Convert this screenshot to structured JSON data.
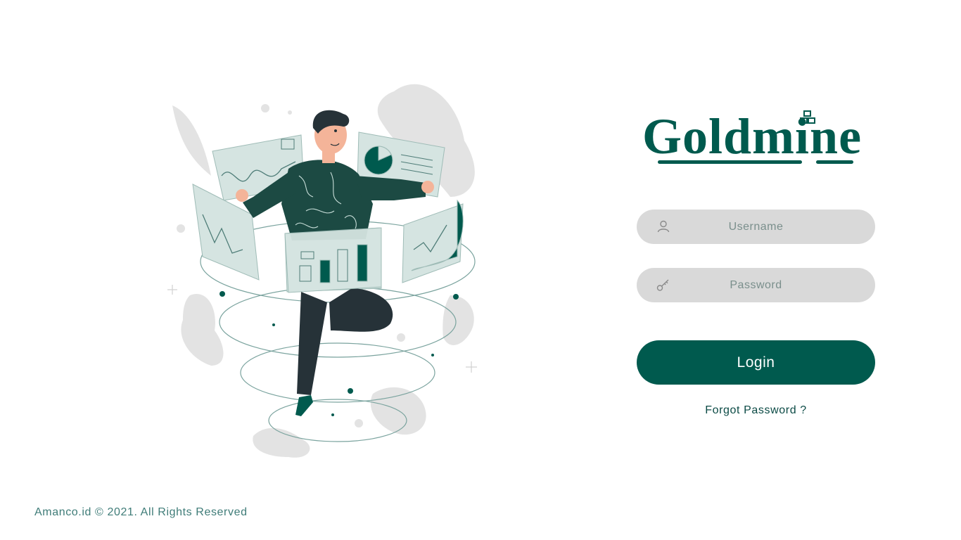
{
  "brand": {
    "name": "Goldmine",
    "color": "#005a4e"
  },
  "form": {
    "username_placeholder": "Username",
    "password_placeholder": "Password",
    "login_label": "Login",
    "forgot_label": "Forgot Password ?"
  },
  "icons": {
    "username": "user-icon",
    "password": "key-icon",
    "brand": "gold-bars-icon"
  },
  "footer": {
    "text": "Amanco.id © 2021. All Rights Reserved"
  },
  "colors": {
    "primary": "#005a4e",
    "field_bg": "#d9d9d9",
    "text": "#0b4a45"
  }
}
